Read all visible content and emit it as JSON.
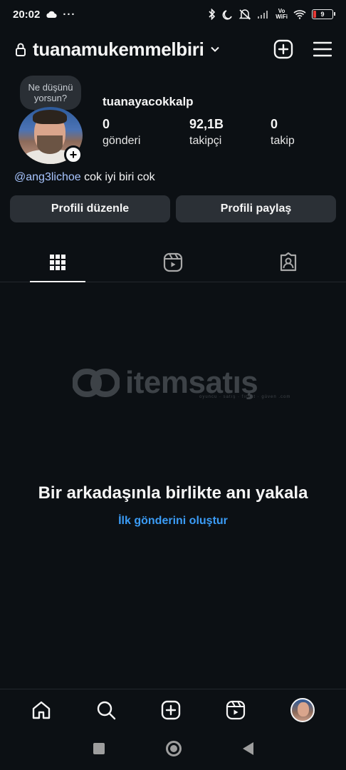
{
  "status_bar": {
    "time": "20:02",
    "more": "···",
    "vowifi": [
      "Vo",
      "WiFi"
    ],
    "battery": "9"
  },
  "header": {
    "username": "tuanamukemmelbiri"
  },
  "profile": {
    "note": [
      "Ne düşünü",
      "yorsun?"
    ],
    "display_name": "tuanayacokkalp",
    "add_story": "+",
    "stats": [
      {
        "value": "0",
        "label": "gönderi"
      },
      {
        "value": "92,1B",
        "label": "takipçi"
      },
      {
        "value": "0",
        "label": "takip"
      }
    ],
    "bio_mention": "@ang3lichoe",
    "bio_text": " cok iyi biri cok"
  },
  "buttons": {
    "edit_profile": "Profili düzenle",
    "share_profile": "Profili paylaş"
  },
  "watermark": {
    "text": "itemsatış",
    "sub": "oyuncu · satış · fırsat · güven .com"
  },
  "empty_state": {
    "title": "Bir arkadaşınla birlikte anı yakala",
    "link": "İlk gönderini oluştur"
  },
  "colors": {
    "background": "#0c1014",
    "button_bg": "#2b3036",
    "link": "#3b9cf6",
    "mention": "#a8c5ff"
  }
}
